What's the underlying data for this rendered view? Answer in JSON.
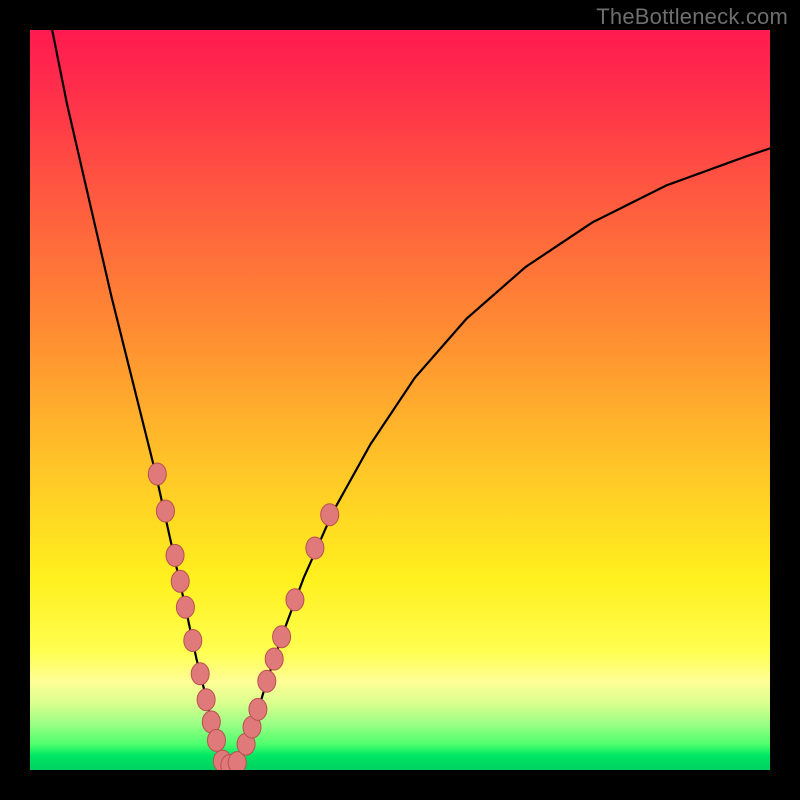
{
  "watermark": "TheBottleneck.com",
  "colors": {
    "frame": "#000000",
    "curve_stroke": "#000000",
    "marker_fill": "#e07a7a",
    "marker_stroke": "#b85050"
  },
  "chart_data": {
    "type": "line",
    "title": "",
    "xlabel": "",
    "ylabel": "",
    "xlim": [
      0,
      100
    ],
    "ylim": [
      0,
      100
    ],
    "grid": false,
    "legend": false,
    "comment": "V-shaped bottleneck curve on rainbow gradient. Minimum (vertex) near x≈26 at y≈0. Values estimated from pixels; no axis ticks or labels visible.",
    "series": [
      {
        "name": "bottleneck-curve",
        "x": [
          3,
          5,
          8,
          11,
          14,
          17,
          19,
          21,
          22.5,
          24,
          25,
          26,
          27,
          28,
          29,
          30.5,
          32,
          34,
          37,
          41,
          46,
          52,
          59,
          67,
          76,
          86,
          97,
          100
        ],
        "y": [
          100,
          90,
          77,
          64,
          52,
          40,
          31,
          22,
          15,
          9,
          4,
          1,
          0.5,
          1,
          3,
          7,
          12,
          18,
          26,
          35,
          44,
          53,
          61,
          68,
          74,
          79,
          83,
          84
        ]
      }
    ],
    "markers": {
      "comment": "salmon bead markers clustered on both arms of the V near the bottom",
      "points": [
        {
          "x": 17.2,
          "y": 40
        },
        {
          "x": 18.3,
          "y": 35
        },
        {
          "x": 19.6,
          "y": 29
        },
        {
          "x": 20.3,
          "y": 25.5
        },
        {
          "x": 21.0,
          "y": 22
        },
        {
          "x": 22.0,
          "y": 17.5
        },
        {
          "x": 23.0,
          "y": 13
        },
        {
          "x": 23.8,
          "y": 9.5
        },
        {
          "x": 24.5,
          "y": 6.5
        },
        {
          "x": 25.2,
          "y": 4
        },
        {
          "x": 26.0,
          "y": 1.2
        },
        {
          "x": 27.0,
          "y": 0.6
        },
        {
          "x": 28.0,
          "y": 1.0
        },
        {
          "x": 29.2,
          "y": 3.5
        },
        {
          "x": 30.0,
          "y": 5.8
        },
        {
          "x": 30.8,
          "y": 8.2
        },
        {
          "x": 32.0,
          "y": 12
        },
        {
          "x": 33.0,
          "y": 15
        },
        {
          "x": 34.0,
          "y": 18
        },
        {
          "x": 35.8,
          "y": 23
        },
        {
          "x": 38.5,
          "y": 30
        },
        {
          "x": 40.5,
          "y": 34.5
        }
      ]
    }
  }
}
